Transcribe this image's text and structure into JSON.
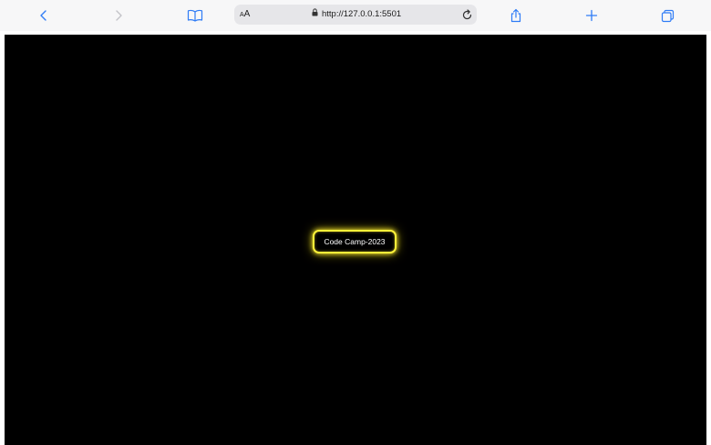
{
  "browser": {
    "text_size_label": "AA",
    "url": "http://127.0.0.1:5501",
    "icons": {
      "back": "chevron-left-icon",
      "forward": "chevron-right-icon",
      "bookmarks": "book-icon",
      "lock": "lock-icon",
      "reload": "reload-icon",
      "share": "share-icon",
      "new_tab": "plus-icon",
      "tabs": "tabs-icon"
    },
    "accent_color": "#2f7cf6"
  },
  "page": {
    "background_color": "#000000",
    "button": {
      "label": "Code Camp-2023",
      "glow_color": "#fff23a"
    }
  }
}
